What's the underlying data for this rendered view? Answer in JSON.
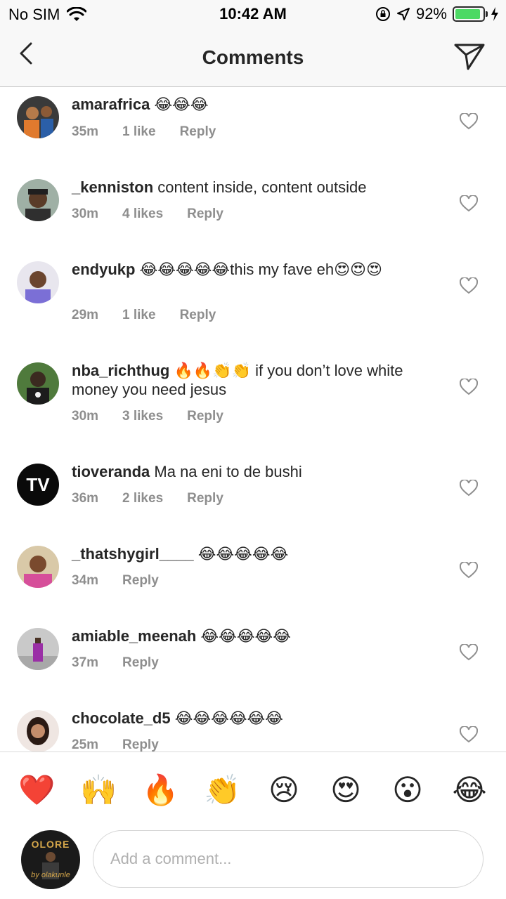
{
  "status_bar": {
    "carrier": "No SIM",
    "time": "10:42 AM",
    "battery_percent": "92%",
    "battery_level": 0.92,
    "icons": [
      "wifi-icon",
      "orientation-lock-icon",
      "location-arrow-icon",
      "battery-icon",
      "charging-bolt-icon"
    ]
  },
  "nav": {
    "title": "Comments",
    "back_icon": "chevron-left-icon",
    "send_icon": "paper-plane-icon"
  },
  "comments": [
    {
      "username": "amarafrica",
      "text": "😂😂😂",
      "time": "35m",
      "likes": "1 like",
      "reply": "Reply"
    },
    {
      "username": "_kenniston",
      "text": "content inside, content outside",
      "time": "30m",
      "likes": "4 likes",
      "reply": "Reply"
    },
    {
      "username": "endyukp",
      "text": "😂😂😂😂😂this my fave eh😍😍😍",
      "time": "29m",
      "likes": "1 like",
      "reply": "Reply"
    },
    {
      "username": "nba_richthug",
      "text": "🔥🔥👏👏 if you don’t love white money you need jesus",
      "time": "30m",
      "likes": "3 likes",
      "reply": "Reply"
    },
    {
      "username": "tioveranda",
      "text": "Ma na eni to de bushi",
      "time": "36m",
      "likes": "2 likes",
      "reply": "Reply",
      "avatar_text": "TV"
    },
    {
      "username": "_thatshygirl____",
      "text": "😂😂😂😂😂",
      "time": "34m",
      "likes": "",
      "reply": "Reply"
    },
    {
      "username": "amiable_meenah",
      "text": "😂😂😂😂😂",
      "time": "37m",
      "likes": "",
      "reply": "Reply"
    },
    {
      "username": "chocolate_d5",
      "text": "😂😂😂😂😂😂",
      "time": "25m",
      "likes": "",
      "reply": "Reply"
    }
  ],
  "quick_emojis": [
    "❤️",
    "🙌",
    "🔥",
    "👏",
    "😢",
    "😍",
    "😮",
    "😂"
  ],
  "composer": {
    "placeholder": "Add a comment...",
    "avatar_text": "OLORE",
    "avatar_subtext": "by olakunle"
  },
  "colors": {
    "muted": "#8e8e8e",
    "text": "#262626",
    "battery_green": "#4cd964"
  }
}
